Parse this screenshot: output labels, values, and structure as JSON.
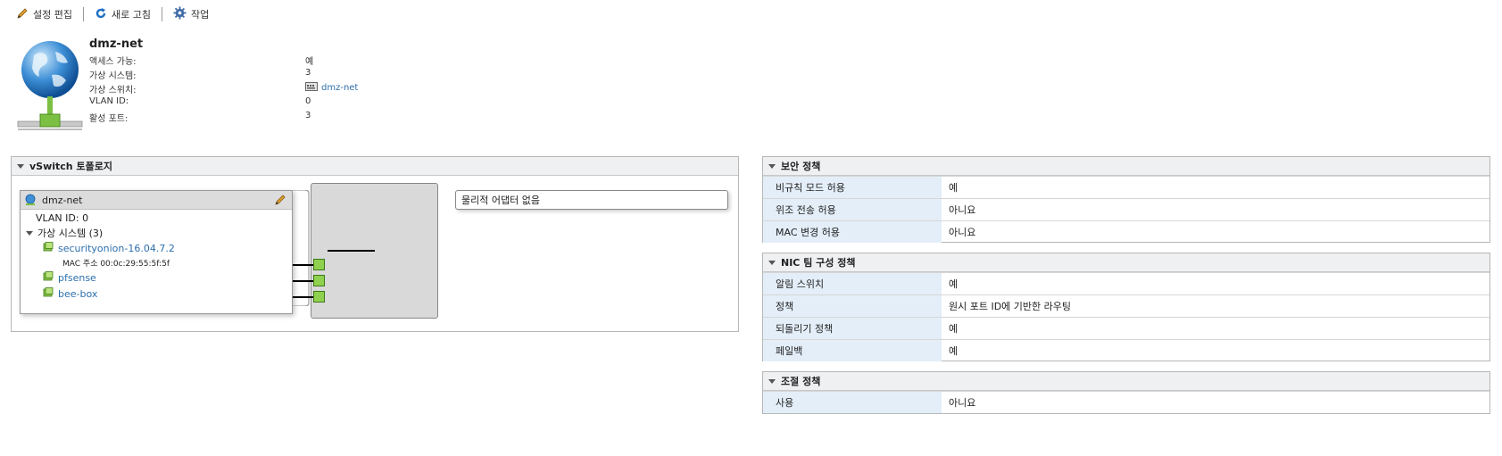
{
  "toolbar": {
    "edit_label": "설정 편집",
    "refresh_label": "새로 고침",
    "actions_label": "작업"
  },
  "header": {
    "title": "dmz-net",
    "props": [
      {
        "label": "액세스 가능:",
        "value": "예"
      },
      {
        "label": "가상 시스템:",
        "value": "3"
      },
      {
        "label": "가상 스위치:",
        "value": "dmz-net"
      },
      {
        "label": "VLAN ID:",
        "value": "0"
      },
      {
        "label": "활성 포트:",
        "value": "3"
      }
    ]
  },
  "topology": {
    "title": "vSwitch 토폴로지",
    "portgroup_name": "dmz-net",
    "vlan_text": "VLAN ID: 0",
    "vms_header": "가상 시스템 (3)",
    "vms": [
      {
        "name": "securityonion-16.04.7.2",
        "mac": "MAC 주소 00:0c:29:55:5f:5f"
      },
      {
        "name": "pfsense"
      },
      {
        "name": "bee-box"
      }
    ],
    "no_adapter_text": "물리적 어댑터 없음"
  },
  "security_policy": {
    "title": "보안 정책",
    "rows": [
      {
        "key": "비규칙 모드 허용",
        "value": "예"
      },
      {
        "key": "위조 전송 허용",
        "value": "아니요"
      },
      {
        "key": "MAC 변경 허용",
        "value": "아니요"
      }
    ]
  },
  "nic_policy": {
    "title": "NIC 팀 구성 정책",
    "rows": [
      {
        "key": "알림 스위치",
        "value": "예"
      },
      {
        "key": "정책",
        "value": "원시 포트 ID에 기반한 라우팅"
      },
      {
        "key": "되돌리기 정책",
        "value": "예"
      },
      {
        "key": "페일백",
        "value": "예"
      }
    ]
  },
  "shaping_policy": {
    "title": "조절 정책",
    "rows": [
      {
        "key": "사용",
        "value": "아니요"
      }
    ]
  },
  "colors": {
    "link": "#2c6fad",
    "key_bg": "#e3eef8",
    "port_green": "#8fd14f"
  }
}
